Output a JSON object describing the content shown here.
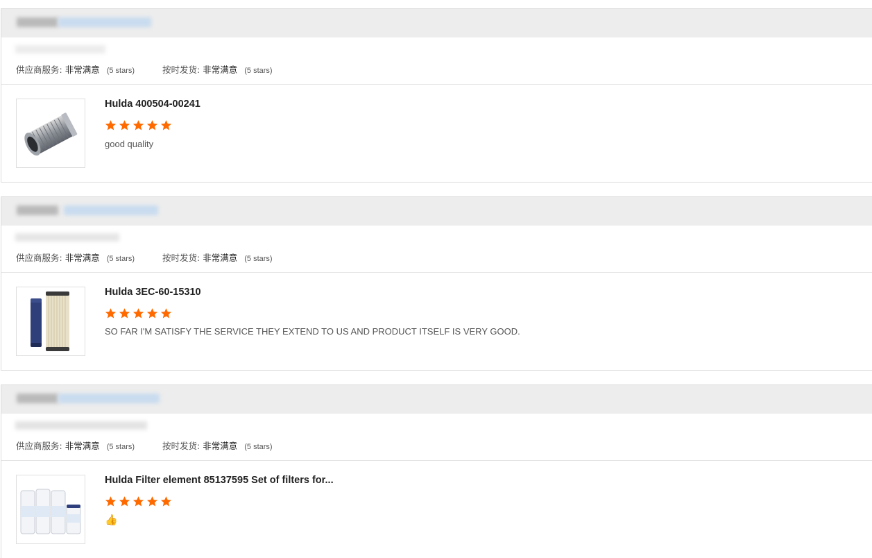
{
  "labels": {
    "supplier_service": "供应商服务:",
    "on_time_delivery": "按时发货:"
  },
  "colors": {
    "star": "#ff6a00",
    "header_bg": "#ededed"
  },
  "reviews": [
    {
      "supplier_rating": "非常满意",
      "supplier_stars": "(5 stars)",
      "delivery_rating": "非常满意",
      "delivery_stars": "(5 stars)",
      "product_title": "Hulda 400504-00241",
      "product_rating": 5,
      "comment": "good quality",
      "thumbnail_icon": "cylindrical-filter-image"
    },
    {
      "supplier_rating": "非常满意",
      "supplier_stars": "(5 stars)",
      "delivery_rating": "非常满意",
      "delivery_stars": "(5 stars)",
      "product_title": "Hulda 3EC-60-15310",
      "product_rating": 5,
      "comment": "SO FAR I'M SATISFY THE SERVICE THEY EXTEND TO US AND PRODUCT ITSELF IS VERY GOOD.",
      "thumbnail_icon": "air-filter-pair-image"
    },
    {
      "supplier_rating": "非常满意",
      "supplier_stars": "(5 stars)",
      "delivery_rating": "非常满意",
      "delivery_stars": "(5 stars)",
      "product_title": "Hulda Filter element 85137595 Set of filters for...",
      "product_rating": 5,
      "comment": "👍",
      "thumbnail_icon": "filter-set-image"
    }
  ]
}
